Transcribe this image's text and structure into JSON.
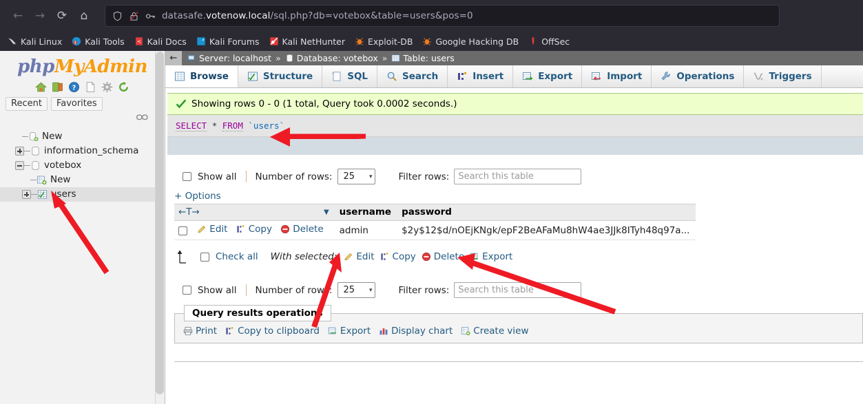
{
  "browser": {
    "nav": [
      {
        "name": "back-button",
        "glyph": "←"
      },
      {
        "name": "forward-button",
        "glyph": "→"
      },
      {
        "name": "reload-button",
        "glyph": "⟳"
      },
      {
        "name": "home-button",
        "glyph": "⌂"
      }
    ],
    "url": {
      "prefix": "datasafe.",
      "host": "votenow.local",
      "path": "/sql.php?db=votebox&table=users&pos=0",
      "full": "datasafe.votenow.local/sql.php?db=votebox&table=users&pos=0"
    },
    "url_icons": [
      "shield-icon",
      "broken-lock-icon",
      "key-icon"
    ],
    "bookmarks": [
      {
        "label": "Kali Linux",
        "icon": "kali-dragon-icon"
      },
      {
        "label": "Kali Tools",
        "icon": "kali-tools-icon"
      },
      {
        "label": "Kali Docs",
        "icon": "kali-docs-icon"
      },
      {
        "label": "Kali Forums",
        "icon": "kali-forums-icon"
      },
      {
        "label": "Kali NetHunter",
        "icon": "kali-nethunter-icon"
      },
      {
        "label": "Exploit-DB",
        "icon": "exploitdb-icon"
      },
      {
        "label": "Google Hacking DB",
        "icon": "google-hacking-db-icon"
      },
      {
        "label": "OffSec",
        "icon": "offsec-icon"
      }
    ]
  },
  "sidebar": {
    "logo": {
      "part1": "php",
      "part2": "MyAdmin"
    },
    "icons": [
      "home-icon",
      "logout-icon",
      "help-icon",
      "docs-icon",
      "settings-icon",
      "refresh-icon"
    ],
    "tabs": [
      {
        "label": "Recent"
      },
      {
        "label": "Favorites"
      }
    ],
    "tree": [
      {
        "label": "New",
        "icon": "new-db-icon",
        "twisty": "none",
        "level": 1
      },
      {
        "label": "information_schema",
        "icon": "database-icon",
        "twisty": "plus",
        "level": 1
      },
      {
        "label": "votebox",
        "icon": "database-icon",
        "twisty": "minus",
        "level": 1
      },
      {
        "label": "New",
        "icon": "new-table-icon",
        "twisty": "none",
        "level": 2
      },
      {
        "label": "users",
        "icon": "table-icon",
        "twisty": "plus",
        "level": 2,
        "selected": true
      }
    ]
  },
  "breadcrumb": {
    "back_glyph": "←",
    "server_label": "Server: localhost",
    "database_label": "Database: votebox",
    "table_label": "Table: users",
    "separator": "»"
  },
  "tabs": [
    {
      "label": "Browse",
      "icon": "browse-icon",
      "active": true
    },
    {
      "label": "Structure",
      "icon": "structure-icon",
      "active": false
    },
    {
      "label": "SQL",
      "icon": "sql-icon",
      "active": false
    },
    {
      "label": "Search",
      "icon": "search-icon",
      "active": false
    },
    {
      "label": "Insert",
      "icon": "insert-icon",
      "active": false
    },
    {
      "label": "Export",
      "icon": "export-icon",
      "active": false
    },
    {
      "label": "Import",
      "icon": "import-icon",
      "active": false
    },
    {
      "label": "Operations",
      "icon": "operations-icon",
      "active": false
    },
    {
      "label": "Triggers",
      "icon": "triggers-icon",
      "active": false
    }
  ],
  "result": {
    "status_text": "Showing rows 0 - 0 (1 total, Query took 0.0002 seconds.)",
    "status_icon": "success-check-icon",
    "sql": {
      "keyword1": "SELECT",
      "star": "*",
      "keyword2": "FROM",
      "identifier": "`users`"
    }
  },
  "controls_top": {
    "show_all_label": "Show all",
    "number_of_rows_label": "Number of rows:",
    "number_of_rows_value": "25",
    "filter_rows_label": "Filter rows:",
    "filter_placeholder": "Search this table",
    "options_label": "+ Options"
  },
  "controls_bottom": {
    "show_all_label": "Show all",
    "number_of_rows_label": "Number of rows:",
    "number_of_rows_value": "25",
    "filter_rows_label": "Filter rows:",
    "filter_placeholder": "Search this table"
  },
  "table": {
    "sort_header": "←T→",
    "columns": [
      "username",
      "password"
    ],
    "rows": [
      {
        "actions": [
          {
            "label": "Edit",
            "icon": "pencil-icon"
          },
          {
            "label": "Copy",
            "icon": "copy-icon"
          },
          {
            "label": "Delete",
            "icon": "delete-icon"
          }
        ],
        "username": "admin",
        "password": "$2y$12$d/nOEjKNgk/epF2BeAFaMu8hW4ae3JJk8ITyh48q97a..."
      }
    ]
  },
  "with_selected": {
    "check_all_label": "Check all",
    "label": "With selected:",
    "actions": [
      {
        "label": "Edit",
        "icon": "pencil-icon"
      },
      {
        "label": "Copy",
        "icon": "copy-icon"
      },
      {
        "label": "Delete",
        "icon": "delete-icon"
      },
      {
        "label": "Export",
        "icon": "export-icon"
      }
    ]
  },
  "query_results_operations": {
    "legend": "Query results operations",
    "links": [
      {
        "label": "Print",
        "icon": "printer-icon"
      },
      {
        "label": "Copy to clipboard",
        "icon": "copy-icon"
      },
      {
        "label": "Export",
        "icon": "export-icon"
      },
      {
        "label": "Display chart",
        "icon": "chart-icon"
      },
      {
        "label": "Create view",
        "icon": "create-view-icon"
      }
    ]
  },
  "annotations": {
    "color": "#ee1b24",
    "arrows": [
      {
        "name": "arrow-to-sql-query"
      },
      {
        "name": "arrow-to-users-table"
      },
      {
        "name": "arrow-to-username-cell"
      },
      {
        "name": "arrow-to-password-hash"
      }
    ]
  },
  "colors": {
    "chrome_bg": "#2b2a33",
    "urlbar_bg": "#1c1b22",
    "success_bg": "#eeffcc",
    "sql_bg": "#e5e5e5",
    "link": "#235a81",
    "annotation_red": "#ee1b24"
  }
}
